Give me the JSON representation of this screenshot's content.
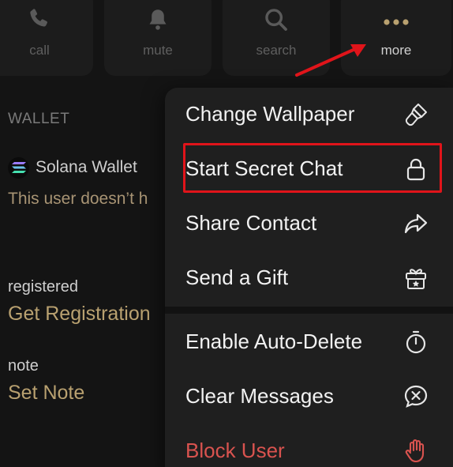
{
  "actions": {
    "call": "call",
    "mute": "mute",
    "search": "search",
    "more": "more"
  },
  "profile": {
    "wallet_section": "WALLET",
    "wallet_name": "Solana Wallet",
    "wallet_sub": "This user doesn’t h",
    "registered_label": "registered",
    "registered_value": "Get Registration",
    "note_label": "note",
    "note_value": "Set Note"
  },
  "menu": {
    "items": [
      {
        "label": "Change Wallpaper",
        "icon": "brush-icon"
      },
      {
        "label": "Start Secret Chat",
        "icon": "lock-icon"
      },
      {
        "label": "Share Contact",
        "icon": "share-arrow-icon"
      },
      {
        "label": "Send a Gift",
        "icon": "gift-icon"
      },
      {
        "label": "Enable Auto-Delete",
        "icon": "timer-icon"
      },
      {
        "label": "Clear Messages",
        "icon": "clear-chat-icon"
      },
      {
        "label": "Block User",
        "icon": "hand-stop-icon"
      }
    ]
  },
  "colors": {
    "accent_gold": "#b9a170",
    "danger": "#d9534f",
    "annotation_red": "#e0141a"
  }
}
